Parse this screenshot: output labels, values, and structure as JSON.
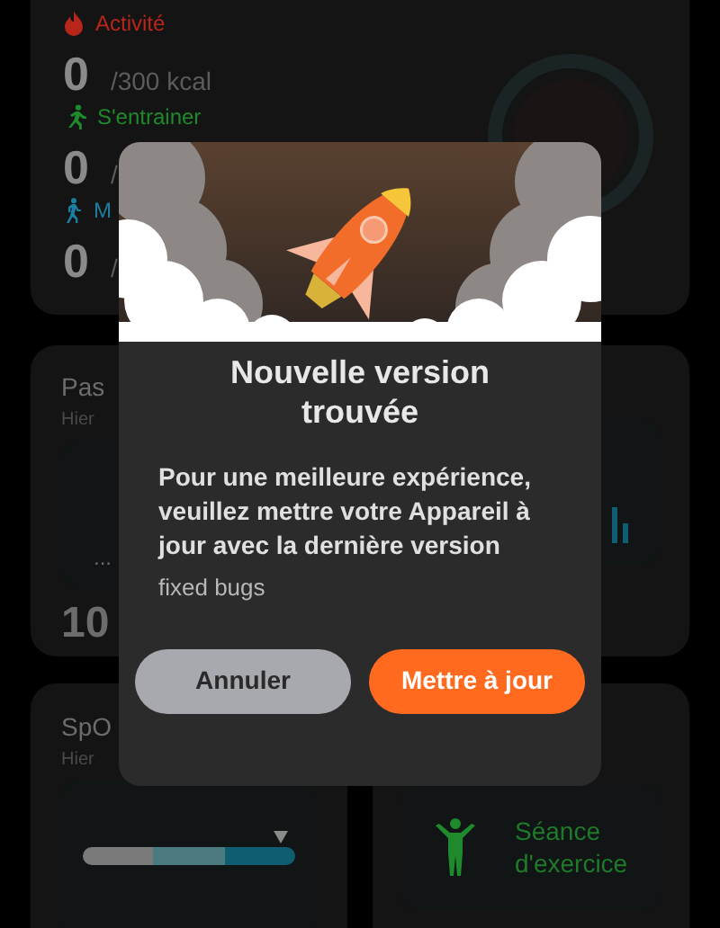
{
  "activity_card": {
    "rows": [
      {
        "kind": "fire",
        "label": "Activité",
        "value": "0",
        "goal": "/300 kcal",
        "color": "#b8261b"
      },
      {
        "kind": "run",
        "label": "S'entrainer",
        "value": "0",
        "goal": "/",
        "color": "#1f8a2c"
      },
      {
        "kind": "walk",
        "label": "M",
        "value": "0",
        "goal": "/",
        "color": "#1a7fa0"
      }
    ]
  },
  "steps_card": {
    "title": "Pas",
    "subtitle": "Hier",
    "placeholder_dots": "...",
    "value": "10"
  },
  "spo2_card": {
    "title": "SpO",
    "subtitle": "Hier"
  },
  "workout_card": {
    "label": "Séance d'exercice"
  },
  "dialog": {
    "title": "Nouvelle version trouvée",
    "message": "Pour une meilleure expérience, veuillez mettre votre Appareil à jour avec la dernière version",
    "note": "fixed bugs",
    "buttons": [
      {
        "kind": "secondary",
        "label": "Annuler"
      },
      {
        "kind": "primary",
        "label": "Mettre à jour"
      }
    ]
  }
}
